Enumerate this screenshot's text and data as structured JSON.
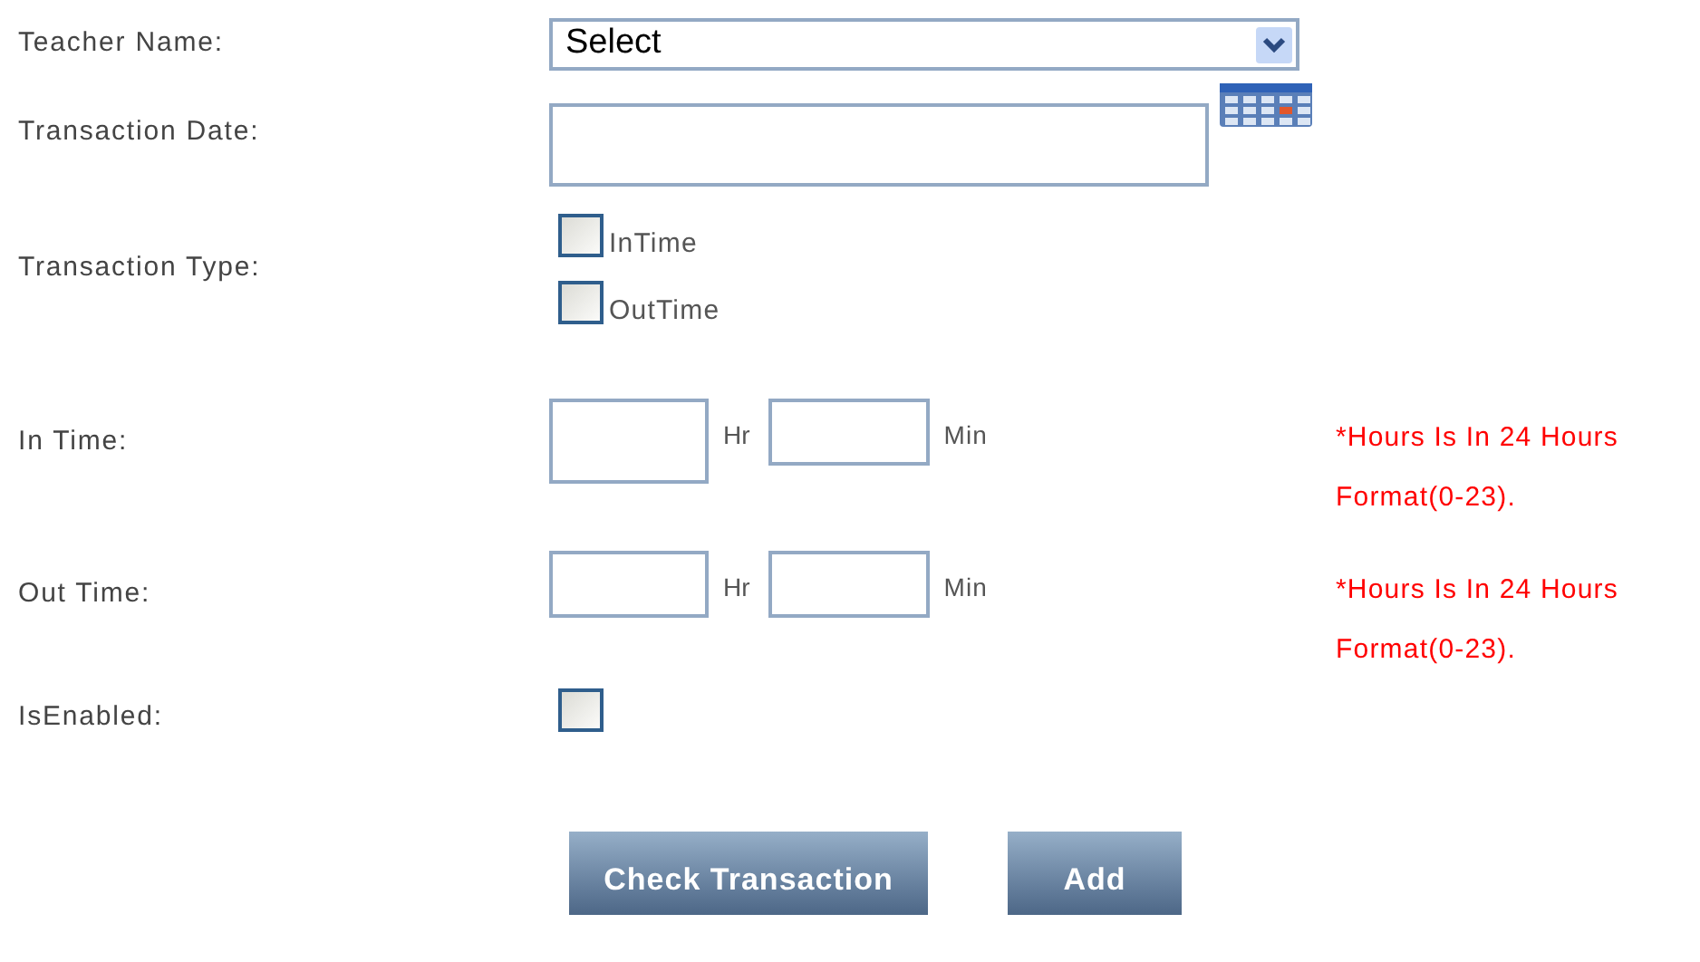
{
  "form": {
    "teacher_name": {
      "label": "Teacher Name:",
      "value": "Select"
    },
    "transaction_date": {
      "label": "Transaction Date:"
    },
    "transaction_type": {
      "label": "Transaction Type:",
      "options": [
        {
          "label": "InTime",
          "checked": false
        },
        {
          "label": "OutTime",
          "checked": false
        }
      ]
    },
    "in_time": {
      "label": "In Time:",
      "hour_unit": "Hr",
      "minute_unit": "Min",
      "note": "*Hours Is In 24 Hours Format(0-23)."
    },
    "out_time": {
      "label": "Out Time:",
      "hour_unit": "Hr",
      "minute_unit": "Min",
      "note": "*Hours Is In 24 Hours Format(0-23)."
    },
    "is_enabled": {
      "label": "IsEnabled:",
      "checked": false
    }
  },
  "buttons": [
    "Check Transaction",
    "Add"
  ]
}
